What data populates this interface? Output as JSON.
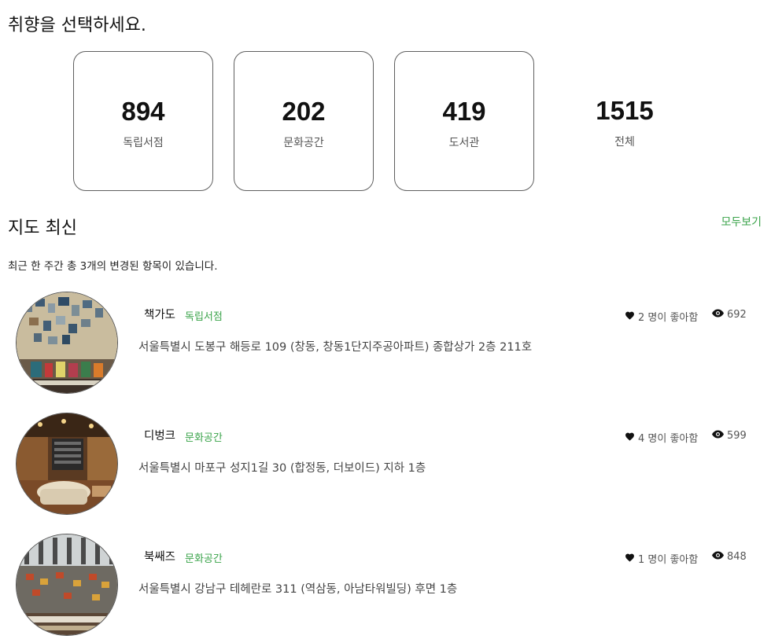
{
  "heading": "취향을 선택하세요.",
  "categories": [
    {
      "count": "894",
      "label": "독립서점"
    },
    {
      "count": "202",
      "label": "문화공간"
    },
    {
      "count": "419",
      "label": "도서관"
    },
    {
      "count": "1515",
      "label": "전체"
    }
  ],
  "map_section": {
    "title": "지도 최신",
    "see_all": "모두보기",
    "description": "최근 한 주간 총 3개의 변경된 항목이 있습니다."
  },
  "places": [
    {
      "name": "책가도",
      "category": "독립서점",
      "address": "서울특별시 도봉구 해등로 109 (창동, 창동1단지주공아파트) 종합상가 2층 211호",
      "likes": "2 명이 좋아함",
      "views": "692"
    },
    {
      "name": "디벙크",
      "category": "문화공간",
      "address": "서울특별시 마포구 성지1길 30 (합정동, 더보이드) 지하 1층",
      "likes": "4 명이 좋아함",
      "views": "599"
    },
    {
      "name": "북쌔즈",
      "category": "문화공간",
      "address": "서울특별시 강남구 테헤란로 311 (역삼동, 아남타워빌딩) 후면 1층",
      "likes": "1 명이 좋아함",
      "views": "848"
    }
  ],
  "colors": {
    "accent_green": "#3aa34a",
    "card_border": "#5f5f5f"
  },
  "icons": {
    "likes": "heart-icon",
    "views": "eye-icon"
  }
}
